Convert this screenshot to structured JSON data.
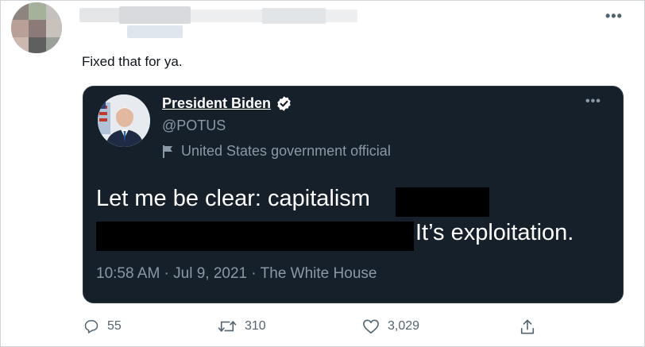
{
  "tweet": {
    "text": "Fixed that for ya.",
    "more_icon": "more-horizontal-icon"
  },
  "quoted_tweet": {
    "name": "President Biden",
    "handle": "@POTUS",
    "label": "United States government official",
    "line1": "Let me be clear: capitalism",
    "line2": "It’s exploitation.",
    "meta": "10:58 AM · Jul 9, 2021 · The White House",
    "verified_icon": "verified-badge-icon",
    "label_icon": "flag-icon"
  },
  "actions": {
    "reply_count": "55",
    "retweet_count": "310",
    "like_count": "3,029"
  },
  "colors": {
    "card_background": "#15202b",
    "muted_text": "#536471",
    "card_muted_text": "#8b98a5"
  }
}
